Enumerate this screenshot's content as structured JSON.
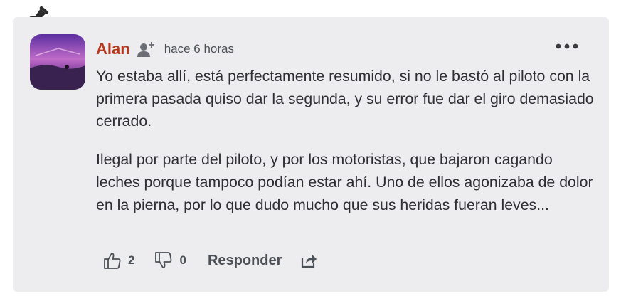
{
  "comment": {
    "author": "Alan",
    "time": "hace 6 horas",
    "paragraphs": [
      "Yo estaba allí, está perfectamente resumido, si no le bastó al piloto con la primera pasada quiso dar la segunda, y su error fue dar el giro demasiado cerrado.",
      "Ilegal por parte del piloto, y por los motoristas, que bajaron cagando leches porque tampoco podían estar ahí. Uno de ellos agonizaba de dolor en la pierna, por lo que dudo mucho que sus heridas fueran leves..."
    ],
    "likes": "2",
    "dislikes": "0",
    "reply_label": "Responder"
  },
  "colors": {
    "author": "#b8361c",
    "card_bg": "#ededf0",
    "text": "#2f2f33",
    "muted": "#4b4f56"
  },
  "icons": [
    "pin-icon",
    "follow-user-icon",
    "more-options-icon",
    "thumbs-up-icon",
    "thumbs-down-icon",
    "share-icon"
  ]
}
